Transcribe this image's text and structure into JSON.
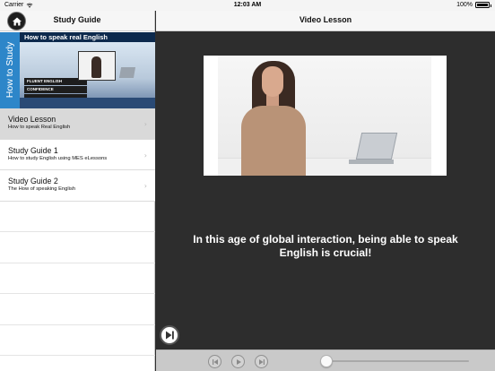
{
  "status_bar": {
    "carrier": "Carrier",
    "time": "12:03 AM",
    "battery_percent": "100%"
  },
  "left_panel": {
    "nav_title": "Study Guide",
    "home_icon": "home-icon",
    "banner": {
      "heading": "How to speak real English",
      "vertical_text": "How to Study",
      "book_labels": [
        "FLUENT ENGLISH",
        "CONFIDENCE",
        ""
      ]
    },
    "items": [
      {
        "title": "Video Lesson",
        "subtitle": "How to speak Real English",
        "selected": true
      },
      {
        "title": "Study Guide 1",
        "subtitle": "How to study English using MES eLessons",
        "selected": false
      },
      {
        "title": "Study Guide 2",
        "subtitle": "The How of speaking English",
        "selected": false
      }
    ],
    "chevron_icon": "chevron-right-icon"
  },
  "right_panel": {
    "nav_title": "Video Lesson",
    "caption": "In this age of global interaction, being able to speak English is crucial!",
    "player": {
      "progress": 0.04
    }
  },
  "colors": {
    "panel_dark": "#2d2d2d",
    "selected_row": "#d9d9d9",
    "banner_blue": "#2d86c9",
    "controls_bar": "#c9c9c9"
  }
}
